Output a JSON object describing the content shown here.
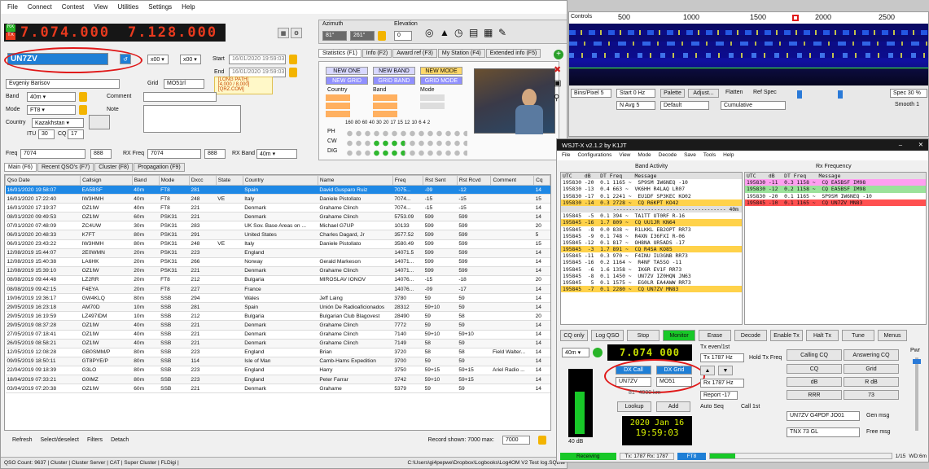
{
  "logger": {
    "menu": [
      "File",
      "Connect",
      "Contest",
      "View",
      "Utilities",
      "Settings",
      "Help"
    ],
    "rx_badge": "RX",
    "tx_badge": "TX",
    "freq_main": "7.074.000",
    "freq_sub": "7.128.000",
    "azimuth_label": "Azimuth",
    "elevation_label": "Elevation",
    "az_short": "81°",
    "az_long": "261°",
    "elevation_value": "0",
    "callsign": "UN7ZV",
    "start_label": "Start",
    "end_label": "End",
    "start_date": "16/01/2020 19:59:03",
    "end_date": "16/01/2020 19:59:03",
    "name": "Evgeniy Barisov",
    "grid_label": "Grid",
    "grid": "MO51rl",
    "band_label": "Band",
    "band": "40m",
    "comment_label": "Comment",
    "mode_label": "Mode",
    "mode": "FT8",
    "note_label": "Note",
    "country_label": "Country",
    "country": "Kazakhstan",
    "itu_label": "ITU",
    "itu": "30",
    "cq_label": "CQ",
    "cq": "17",
    "long_path": "[LONG PATH]",
    "distance": "[4,000 / 8,000]",
    "qrz": "[QRZ.COM]",
    "freq_label": "Freq",
    "freq_value": "7074",
    "rst_sent": "888",
    "rx_freq_label": "RX Freq",
    "rx_freq": "7074",
    "rst_rcvd": "888",
    "rx_band_label": "RX Band",
    "rx_band": "40m",
    "stat_tabs": [
      "Statistics (F1)",
      "Info (F2)",
      "Award ref (F3)",
      "My Station (F4)",
      "Extended info (F5)"
    ],
    "stat_flags": [
      "NEW ONE",
      "NEW BAND",
      "NEW MODE",
      "NEW GRID",
      "GRID BAND",
      "GRID MODE"
    ],
    "stat_headers": [
      "Country",
      "Band",
      "Mode"
    ],
    "stat_bands": [
      "160",
      "80",
      "60",
      "40",
      "30",
      "20",
      "17",
      "15",
      "12",
      "10",
      "6",
      "4",
      "2"
    ],
    "stat_rows": [
      "PH",
      "CW",
      "DIG"
    ],
    "qso_tabs": [
      "Main (F6)",
      "Recent QSO's (F7)",
      "Cluster (F8)",
      "Propagation (F9)"
    ],
    "columns": [
      "Qso Date",
      "Callsign",
      "Band",
      "Mode",
      "Dxcc",
      "State",
      "Country",
      "Name",
      "Freq",
      "Rst Sent",
      "Rst Rcvd",
      "Comment",
      "Cq"
    ],
    "rows": [
      [
        "16/01/2020 19:58:07",
        "EA5BSF",
        "40m",
        "FT8",
        "281",
        "",
        "Spain",
        "David Gusparo Ruiz",
        "7075...",
        "-09",
        "-12",
        "",
        "14"
      ],
      [
        "16/01/2020 17:22:40",
        "IW3HMH",
        "40m",
        "FT8",
        "248",
        "VE",
        "Italy",
        "Daniele Pistollato",
        "7074...",
        "-15",
        "-15",
        "",
        "15"
      ],
      [
        "16/01/2020 17:19:37",
        "OZ1IW",
        "40m",
        "FT8",
        "221",
        "",
        "Denmark",
        "Grahame Clinch",
        "7074...",
        "-15",
        "-15",
        "",
        "14"
      ],
      [
        "08/01/2020 09:49:53",
        "OZ1IW",
        "60m",
        "PSK31",
        "221",
        "",
        "Denmark",
        "Grahame Clinch",
        "5753.09",
        "599",
        "599",
        "",
        "14"
      ],
      [
        "07/01/2020 07:48:09",
        "ZC4UW",
        "30m",
        "PSK31",
        "283",
        "",
        "UK Sov. Base Areas on ...",
        "Michael G7UP",
        "10133",
        "599",
        "599",
        "",
        "20"
      ],
      [
        "06/01/2020 20:48:33",
        "K7FT",
        "80m",
        "PSK31",
        "291",
        "",
        "United States",
        "Charles Dagard, Jr",
        "3577.52",
        "599",
        "599",
        "",
        "5"
      ],
      [
        "06/01/2020 23:43:22",
        "IW3HMH",
        "80m",
        "PSK31",
        "248",
        "VE",
        "Italy",
        "Daniele Pistollato",
        "3580.49",
        "599",
        "599",
        "",
        "15"
      ],
      [
        "12/08/2019 15:44:07",
        "2E0WMN",
        "20m",
        "PSK31",
        "223",
        "",
        "England",
        "",
        "14071.5",
        "599",
        "599",
        "",
        "14"
      ],
      [
        "12/08/2019 15:40:38",
        "LA6HK",
        "20m",
        "PSK31",
        "266",
        "",
        "Norway",
        "Gerald Markeson",
        "14071...",
        "599",
        "599",
        "",
        "14"
      ],
      [
        "12/08/2019 15:39:10",
        "OZ1IW",
        "20m",
        "PSK31",
        "221",
        "",
        "Denmark",
        "Grahame Clinch",
        "14071...",
        "599",
        "599",
        "",
        "14"
      ],
      [
        "08/08/2019 09:44:48",
        "LZ2RR",
        "20m",
        "FT8",
        "212",
        "",
        "Bulgaria",
        "MIROSLAV IONOV",
        "14076...",
        "-15",
        "-18",
        "",
        "20"
      ],
      [
        "08/08/2019 09:42:15",
        "F4EYA",
        "20m",
        "FT8",
        "227",
        "",
        "France",
        "",
        "14076...",
        "-09",
        "-17",
        "",
        "14"
      ],
      [
        "19/06/2019 19:36:17",
        "GW4KLQ",
        "80m",
        "SSB",
        "294",
        "",
        "Wales",
        "Jeff Laing",
        "3780",
        "59",
        "59",
        "",
        "14"
      ],
      [
        "29/05/2019 16:23:18",
        "AM70D",
        "10m",
        "SSB",
        "281",
        "",
        "Spain",
        "Unión De Radioaficionados",
        "28312",
        "59+10",
        "59",
        "",
        "14"
      ],
      [
        "29/05/2019 16:19:59",
        "LZ497IDM",
        "10m",
        "SSB",
        "212",
        "",
        "Bulgaria",
        "Bulgarian Club Blagovest",
        "28490",
        "59",
        "58",
        "",
        "20"
      ],
      [
        "29/05/2019 08:37:28",
        "OZ1IW",
        "40m",
        "SSB",
        "221",
        "",
        "Denmark",
        "Grahame Clinch",
        "7772",
        "59",
        "59",
        "",
        "14"
      ],
      [
        "27/05/2019 07:18:41",
        "OZ1IW",
        "40m",
        "SSB",
        "221",
        "",
        "Denmark",
        "Grahame Clinch",
        "7140",
        "59+10",
        "59+10",
        "",
        "14"
      ],
      [
        "26/05/2019 08:58:21",
        "OZ1IW",
        "40m",
        "SSB",
        "221",
        "",
        "Denmark",
        "Grahame Clinch",
        "7149",
        "58",
        "59",
        "",
        "14"
      ],
      [
        "12/05/2019 12:08:28",
        "GB0SMM/P",
        "80m",
        "SSB",
        "223",
        "",
        "England",
        "Brian",
        "3720",
        "58",
        "58",
        "Field Walter...",
        "14"
      ],
      [
        "09/05/2019 18:50:11",
        "GT8PYE/P",
        "80m",
        "SSB",
        "114",
        "",
        "Isle of Man",
        "Camb-Hams Expedition",
        "3700",
        "59",
        "59",
        "",
        "14"
      ],
      [
        "22/04/2019 09:18:39",
        "G3LO",
        "80m",
        "SSB",
        "223",
        "",
        "England",
        "Harry",
        "3750",
        "59+15",
        "59+15",
        "Ariel Radio ...",
        "14"
      ],
      [
        "18/04/2019 07:33:21",
        "G0IMZ",
        "80m",
        "SSB",
        "223",
        "",
        "England",
        "Peter Farrar",
        "3742",
        "59+10",
        "59+15",
        "",
        "14"
      ],
      [
        "03/04/2019 07:20:38",
        "OZ1IW",
        "60m",
        "SSB",
        "221",
        "",
        "Denmark",
        "Grahame",
        "5379",
        "59",
        "59",
        "",
        "14"
      ]
    ],
    "refresh": "Refresh",
    "select_deselect": "Select/deselect",
    "filters": "Filters",
    "detach": "Detach",
    "record_shown": "Record shown: 7000  max: ",
    "record_max": "7000",
    "status": "QSO Count: 9637  |  Cluster  |  Cluster Server  |  CAT  |  Super Cluster  |  FLDigi  |",
    "path": "C:\\Users\\gi4pepwe\\Dropbox\\Logbooks\\Log4OM V2 Test log.SQLite"
  },
  "waterfall": {
    "controls": "Controls",
    "scale": [
      "500",
      "1000",
      "1500",
      "2000",
      "2500"
    ],
    "row1": [
      "Bins/Pixel 5",
      "Start 0 Hz",
      "Palette",
      "Adjust...",
      "Flatten",
      "Ref Spec",
      "Spec 30 %"
    ],
    "row2": [
      "N Avg 5",
      "Default",
      "Cumulative",
      "Smooth 1"
    ]
  },
  "wsjt": {
    "title": "WSJT-X  v2.1.2  by K1JT",
    "menu": [
      "File",
      "Configurations",
      "View",
      "Mode",
      "Decode",
      "Save",
      "Tools",
      "Help"
    ],
    "band_activity": "Band Activity",
    "rx_frequency": "Rx Frequency",
    "col_header": "UTC    dB   DT Freq    Message",
    "left_rows": [
      [
        "195830 -20  0.1 1165 ~  SP9SM IW6NEQ -10",
        "n"
      ],
      [
        "195830 -13  0.4 663 ~  VK6HH R4LAQ LR07",
        "n"
      ],
      [
        "195830 -17  0.1 2241 ~  EU1DF SP3KEC KO02",
        "n"
      ],
      [
        "195830 -14  0.3 2728 ~  CQ R6KPT KO42",
        "cq"
      ],
      [
        "------------------------------------ 40m",
        "sep"
      ],
      [
        "195845  -5  0.1 394 ~  TA1TT UT0RF R-16",
        "n"
      ],
      [
        "195845 -16  1.7 809 ~  CQ UU1JR KN64",
        "cq"
      ],
      [
        "195845  -8  0.0 838 ~  R1LKKL EB2OPT RR73",
        "n"
      ],
      [
        "195845  -9  0.1 748 ~  R4XN I36FXI R-06",
        "n"
      ],
      [
        "195845 -12  0.1 817 ~  OH8NA UR5ADS -17",
        "n"
      ],
      [
        "195845  -3  1.7 891 ~  CQ R4SA KO85",
        "cq"
      ],
      [
        "195845 -11  0.3 970 ~  F4INU IU3GNB RR73",
        "n"
      ],
      [
        "195845 -16  0.2 1164 ~  R4NF TA5SO -11",
        "n"
      ],
      [
        "195845  -6  1.6 1358 ~  IK6R EV1F RR73",
        "n"
      ],
      [
        "195845  -8  0.1 1450 ~  UN7ZV IZ0HQN JN63",
        "n"
      ],
      [
        "195845   5  0.1 1575 ~  EG0LR EA4AWW RR73",
        "n"
      ],
      [
        "195845  -7  0.1 2280 ~  CQ UN7ZV MN83",
        "cq"
      ]
    ],
    "right_rows": [
      [
        "195830 -11  0.3 1158 ~  CQ EA5BSF IM98",
        "m"
      ],
      [
        "195830 -12  0.2 1158 ~  CQ EA5BSF IM98",
        "g"
      ],
      [
        "195830 -20  0.1 1165 ~  SP9SM IW6NEQ -10",
        "n"
      ],
      [
        "195845 -10  0.1 1165 ~  CQ UN7ZV MN83",
        "r"
      ]
    ],
    "buttons": [
      "CQ only",
      "Log QSO",
      "Stop",
      "Monitor",
      "Erase",
      "Decode",
      "Enable Tx",
      "Halt Tx",
      "Tune",
      "Menus"
    ],
    "band": "40m",
    "dial": "7.074 000",
    "tx_even": "Tx even/1st",
    "tx_hz": "Tx  1787 Hz",
    "rx_hz": "Rx  1787 Hz",
    "hold_tx": "Hold Tx Freq",
    "dx_call_label": "DX Call",
    "dx_grid_label": "DX Grid",
    "dx_call": "UN7ZV",
    "dx_grid": "MO51",
    "az_dist": "81°  4000 km",
    "report": "Report -17",
    "lookup": "Lookup",
    "add": "Add",
    "auto_seq": "Auto Seq",
    "call_1st": "Call 1st",
    "date": "2020 Jan 16",
    "time": "19:59:03",
    "db": "40 dB",
    "tab_headers": [
      "Calling CQ",
      "Answering CQ"
    ],
    "tab_cells": [
      [
        "CQ",
        "Grid"
      ],
      [
        "dB",
        "R dB"
      ],
      [
        "RRR",
        "73"
      ]
    ],
    "gen_msg_value": "UN7ZV G4PDF JO01",
    "gen_msg": "Gen msg",
    "free_msg_value": "TNX 73 GL",
    "free_msg": "Free msg",
    "pwr": "Pwr",
    "status_receiving": "Receiving",
    "status_tx": "Tx: 1787  Rx: 1787",
    "status_mode": "FT8",
    "status_count": "1/15",
    "status_wd": "WD:6m"
  },
  "colors": {
    "accent_blue": "#1e88e5",
    "led_red": "#e83a1e",
    "cq_yellow": "#ffd24a",
    "monitor_green": "#18c828",
    "dial_green": "#c8e000"
  }
}
